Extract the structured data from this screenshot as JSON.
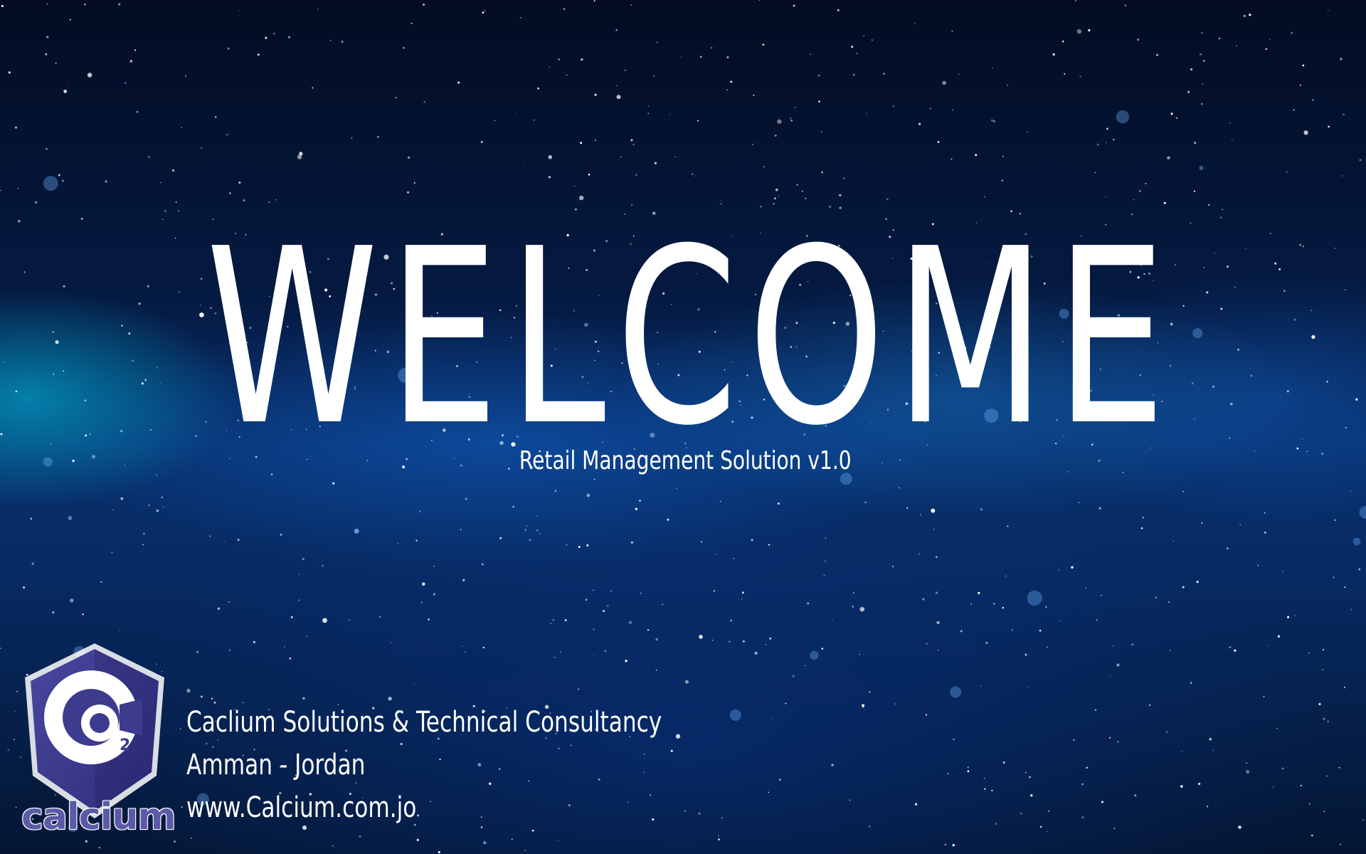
{
  "splash": {
    "title": "WELCOME",
    "subtitle": "Retail Management Solution v1.0"
  },
  "company": {
    "name": "Caclium Solutions & Technical Consultancy",
    "location": "Amman - Jordan",
    "website": "www.Calcium.com.jo"
  },
  "logo": {
    "wordmark": "calcium",
    "icon": "calcium-logo-icon",
    "subscript": "2"
  },
  "colors": {
    "background_top": "#030c22",
    "background_mid": "#08306e",
    "nebula_cyan": "#00c8e6",
    "text": "#ffffff",
    "logo_purple": "#3d3b8e",
    "logo_wordmark": "#5b5aa6"
  }
}
